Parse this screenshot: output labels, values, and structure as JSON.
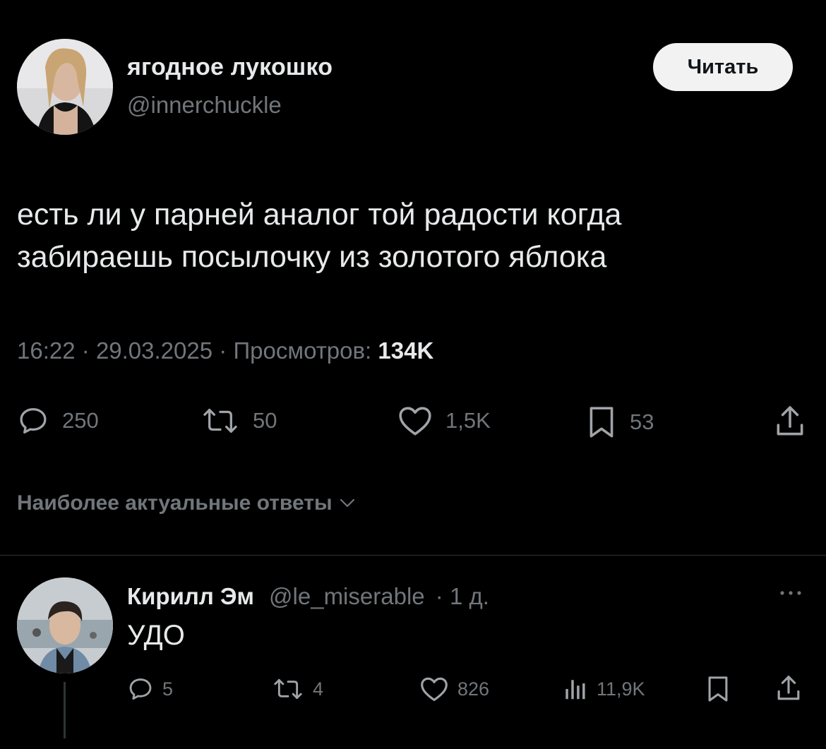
{
  "tweet": {
    "author": {
      "display_name": "ягодное лукошко",
      "handle": "@innerchuckle"
    },
    "follow_label": "Читать",
    "text_lines": [
      "есть ли у парней аналог той радости когда",
      "забираешь посылочку из золотого яблока"
    ],
    "time": "16:22",
    "date": "29.03.2025",
    "views_label": "Просмотров:",
    "views_count": "134K",
    "separator": "·",
    "actions": {
      "replies": "250",
      "retweets": "50",
      "likes": "1,5K",
      "bookmarks": "53"
    }
  },
  "replies_sort": {
    "label": "Наиболее актуальные ответы"
  },
  "reply": {
    "display_name": "Кирилл Эм",
    "handle": "@le_miserable",
    "time": "· 1 д.",
    "text": "УДО",
    "actions": {
      "replies": "5",
      "retweets": "4",
      "likes": "826",
      "views": "11,9K"
    }
  },
  "icons": {
    "reply": "speech-bubble-icon",
    "retweet": "retweet-icon",
    "like": "heart-icon",
    "bookmark": "bookmark-icon",
    "share": "share-icon",
    "views": "bar-chart-icon",
    "more": "more-dots-icon",
    "chevron": "chevron-down-icon"
  },
  "colors": {
    "background": "#000000",
    "text_primary": "#e7e9ea",
    "text_secondary": "#71767b",
    "button_bg": "#f2f2f2",
    "divider": "#2f3336"
  }
}
